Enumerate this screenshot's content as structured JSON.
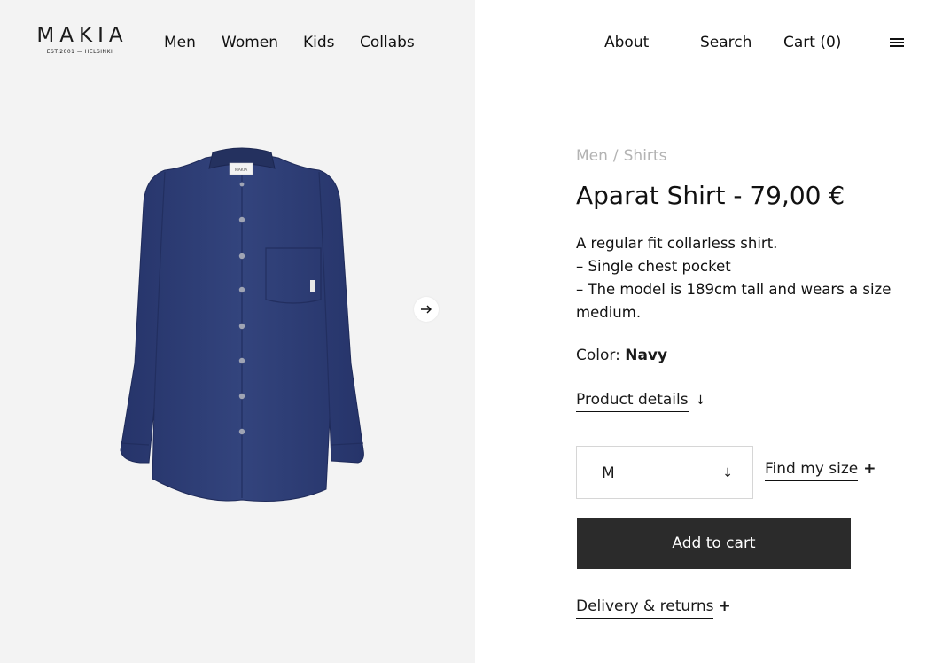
{
  "brand": {
    "name": "MAKIA",
    "tagline": "EST.2001 — HELSINKI"
  },
  "nav": {
    "left": [
      "Men",
      "Women",
      "Kids",
      "Collabs"
    ],
    "right": [
      "About",
      "Search",
      "Cart (0)"
    ]
  },
  "breadcrumb": [
    "Men",
    "Shirts"
  ],
  "breadcrumb_separator": "/",
  "product": {
    "title": "Aparat Shirt - 79,00 €",
    "description": [
      "A regular fit collarless shirt.",
      "– Single chest pocket",
      "– The model is 189cm tall and wears a size",
      "medium."
    ],
    "color_label": "Color:",
    "color_value": "Navy",
    "shirt_color": "#2e3e74",
    "collar_label": "MAKIA"
  },
  "actions": {
    "product_details": "Product details",
    "size_selected": "M",
    "find_my_size": "Find my size",
    "add_to_cart": "Add to cart",
    "delivery_returns": "Delivery & returns"
  },
  "icons": {
    "menu": "menu-icon",
    "next": "arrow-right-icon",
    "down": "arrow-down-icon",
    "plus": "plus-icon"
  },
  "colors": {
    "left_bg": "#f3f3f3",
    "button_bg": "#2b2b2b",
    "breadcrumb": "#b3b3b3"
  }
}
